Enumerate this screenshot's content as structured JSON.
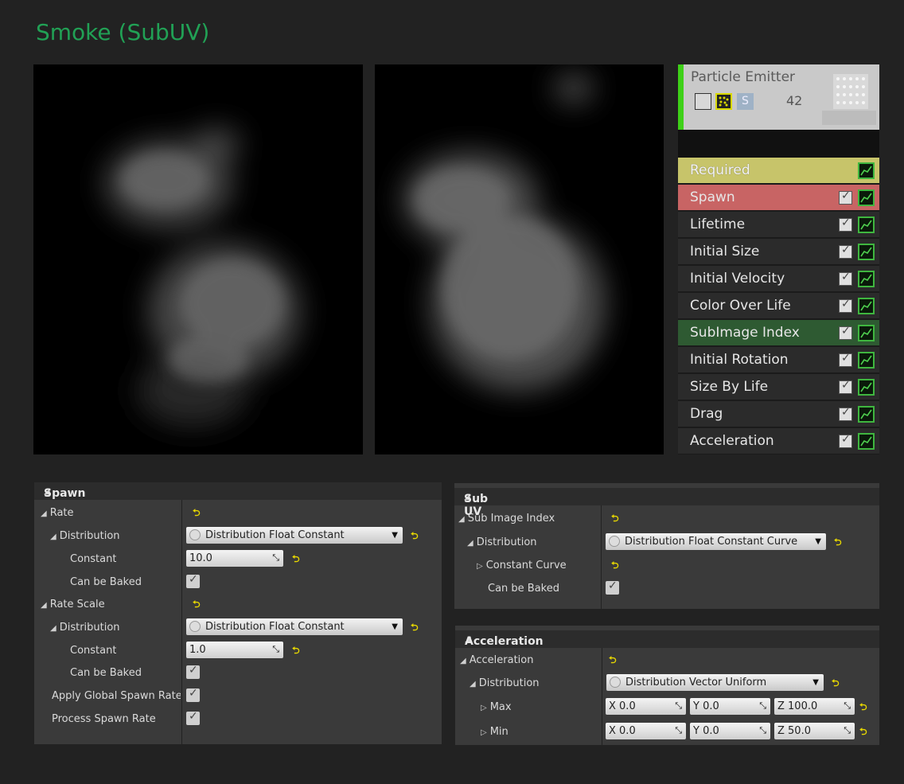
{
  "title": "Smoke (SubUV)",
  "emitter": {
    "title": "Particle Emitter",
    "count": "42",
    "s_label": "S",
    "accent": "#3ed018",
    "modules": [
      {
        "label": "Required",
        "style": "req",
        "check": false
      },
      {
        "label": "Spawn",
        "style": "spawn",
        "check": true
      },
      {
        "label": "Lifetime",
        "style": "",
        "check": true
      },
      {
        "label": "Initial Size",
        "style": "",
        "check": true
      },
      {
        "label": "Initial Velocity",
        "style": "",
        "check": true
      },
      {
        "label": "Color Over Life",
        "style": "",
        "check": true
      },
      {
        "label": "SubImage Index",
        "style": "sub",
        "check": true
      },
      {
        "label": "Initial Rotation",
        "style": "",
        "check": true
      },
      {
        "label": "Size By Life",
        "style": "",
        "check": true
      },
      {
        "label": "Drag",
        "style": "",
        "check": true
      },
      {
        "label": "Acceleration",
        "style": "",
        "check": true
      }
    ]
  },
  "spawn_panel": {
    "header": "Spawn",
    "rate": "Rate",
    "distribution": "Distribution",
    "dist_value": "Distribution Float Constant",
    "constant": "Constant",
    "constant_value": "10.0",
    "can_be_baked": "Can be Baked",
    "rate_scale": "Rate Scale",
    "rs_distribution": "Distribution",
    "rs_dist_value": "Distribution Float Constant",
    "rs_constant": "Constant",
    "rs_constant_value": "1.0",
    "rs_can_be_baked": "Can be Baked",
    "apply_global": "Apply Global Spawn Rate Scale",
    "process_spawn": "Process Spawn Rate"
  },
  "subuv_panel": {
    "header": "Sub UV",
    "sub_image_index": "Sub Image Index",
    "distribution": "Distribution",
    "dist_value": "Distribution Float Constant Curve",
    "constant_curve": "Constant Curve",
    "can_be_baked": "Can be Baked"
  },
  "accel_panel": {
    "header": "Acceleration",
    "acceleration": "Acceleration",
    "distribution": "Distribution",
    "dist_value": "Distribution Vector Uniform",
    "max": "Max",
    "min": "Min",
    "max_x": "X  0.0",
    "max_y": "Y  0.0",
    "max_z": "Z  100.0",
    "min_x": "X  0.0",
    "min_y": "Y  0.0",
    "min_z": "Z  50.0"
  }
}
